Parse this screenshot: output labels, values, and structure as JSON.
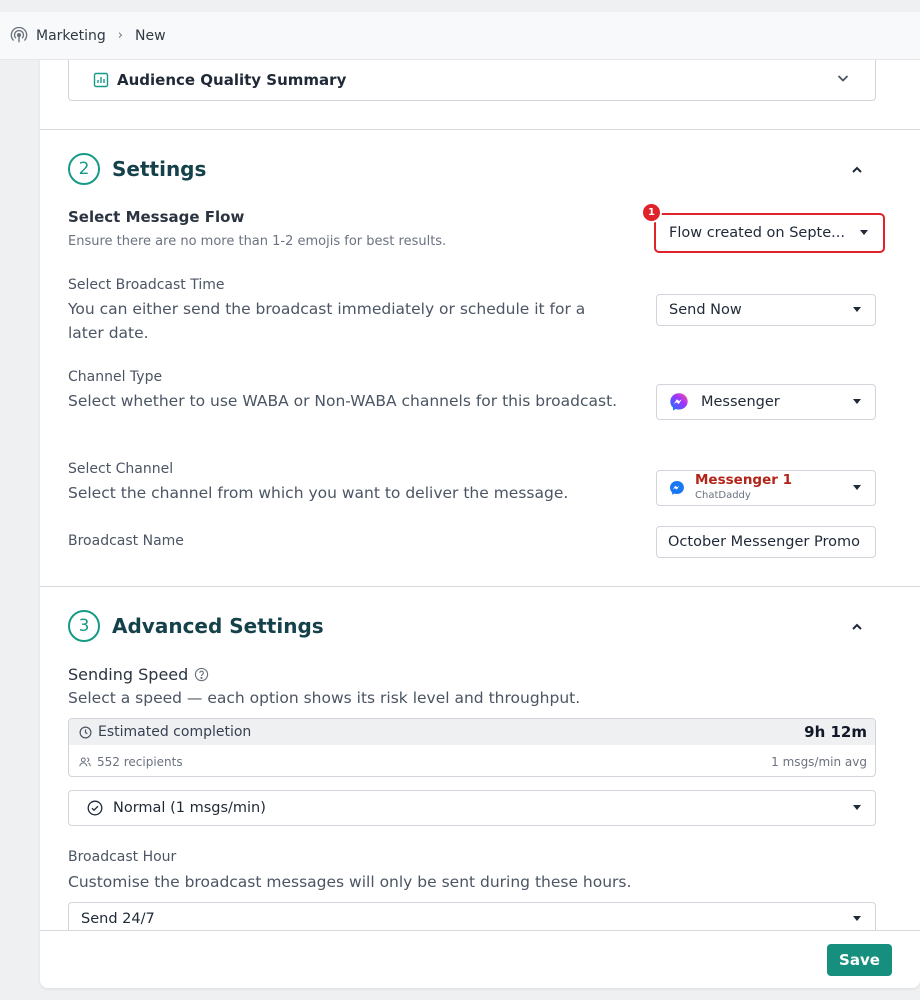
{
  "breadcrumb": {
    "parent": "Marketing",
    "current": "New"
  },
  "audience": {
    "title": "Audience Quality Summary"
  },
  "settings": {
    "number": "2",
    "title": "Settings",
    "message_flow": {
      "label": "Select Message Flow",
      "hint": "Ensure there are no more than 1-2 emojis for best results.",
      "value": "Flow created on Septe...",
      "badge": "1"
    },
    "broadcast_time": {
      "label": "Select Broadcast Time",
      "desc": "You can either send the broadcast immediately or schedule it for a later date.",
      "value": "Send Now"
    },
    "channel_type": {
      "label": "Channel Type",
      "desc": "Select whether to use WABA or Non-WABA channels for this broadcast.",
      "value": "Messenger"
    },
    "channel": {
      "label": "Select Channel",
      "desc": "Select the channel from which you want to deliver the message.",
      "value": "Messenger 1",
      "sub": "ChatDaddy"
    },
    "broadcast_name": {
      "label": "Broadcast Name",
      "value": "October Messenger Promo"
    }
  },
  "advanced": {
    "number": "3",
    "title": "Advanced Settings",
    "speed": {
      "label": "Sending Speed",
      "desc": "Select a speed — each option shows its risk level and throughput.",
      "estimate_label": "Estimated completion",
      "estimate_value": "9h 12m",
      "recipients": "552 recipients",
      "avg": "1 msgs/min avg",
      "value": "Normal (1 msgs/min)"
    },
    "hour": {
      "label": "Broadcast Hour",
      "desc": "Customise the broadcast messages will only be sent during these hours.",
      "value": "Send 24/7"
    }
  },
  "footer": {
    "save_label": "Save"
  },
  "colors": {
    "accent": "#178f7e",
    "highlight": "#e0222a",
    "channel_name": "#b42318"
  }
}
